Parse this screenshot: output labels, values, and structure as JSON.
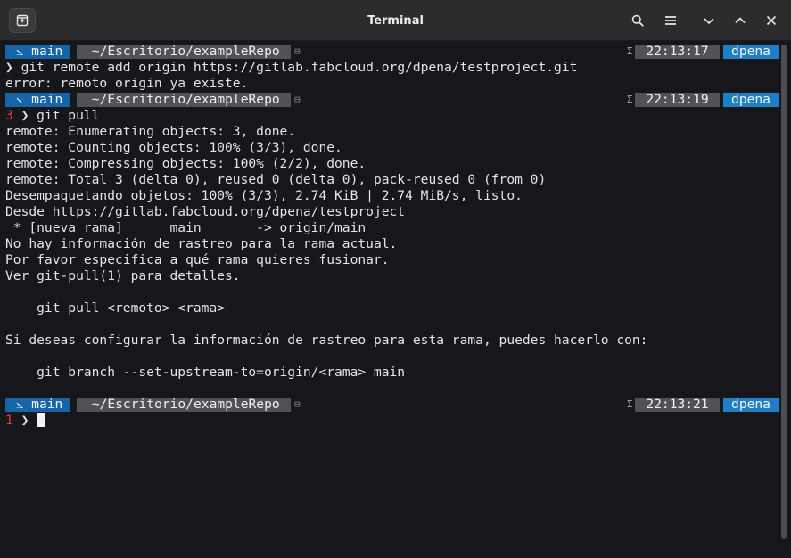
{
  "window": {
    "title": "Terminal"
  },
  "titlebar": {
    "new_tab_icon": "new-tab-icon",
    "search_icon": "search-icon",
    "menu_icon": "hamburger-menu-icon",
    "minimize_icon": "chevron-down-icon",
    "maximize_icon": "chevron-up-icon",
    "close_icon": "close-icon"
  },
  "colors": {
    "branch_segment": "#1565a8",
    "path_segment": "#505256",
    "user_segment": "#1e7fc6",
    "error_status": "#e33b3b"
  },
  "prompts": [
    {
      "branch": "⦣ main",
      "path": " ~/Escritorio/exampleRepo",
      "path_icon": "⊟",
      "sigma": "Σ",
      "time": "22:13:17",
      "user": "dpena"
    },
    {
      "branch": "⦣ main",
      "path": " ~/Escritorio/exampleRepo",
      "path_icon": "⊟",
      "sigma": "Σ",
      "time": "22:13:19",
      "user": "dpena"
    },
    {
      "branch": "⦣ main",
      "path": " ~/Escritorio/exampleRepo",
      "path_icon": "⊟",
      "sigma": "Σ",
      "time": "22:13:21",
      "user": "dpena"
    }
  ],
  "commands": {
    "first": {
      "prefix": "❯ ",
      "text": "git remote add origin https://gitlab.fabcloud.org/dpena/testproject.git"
    },
    "second": {
      "status": "3",
      "prefix": " ❯ ",
      "text": "git pull"
    },
    "third": {
      "status": "1",
      "prefix": " ❯ "
    }
  },
  "output": {
    "first": [
      "error: remoto origin ya existe."
    ],
    "second": [
      "remote: Enumerating objects: 3, done.",
      "remote: Counting objects: 100% (3/3), done.",
      "remote: Compressing objects: 100% (2/2), done.",
      "remote: Total 3 (delta 0), reused 0 (delta 0), pack-reused 0 (from 0)",
      "Desempaquetando objetos: 100% (3/3), 2.74 KiB | 2.74 MiB/s, listo.",
      "Desde https://gitlab.fabcloud.org/dpena/testproject",
      " * [nueva rama]      main       -> origin/main",
      "No hay información de rastreo para la rama actual.",
      "Por favor especifica a qué rama quieres fusionar.",
      "Ver git-pull(1) para detalles.",
      "",
      "    git pull <remoto> <rama>",
      "",
      "Si deseas configurar la información de rastreo para esta rama, puedes hacerlo con:",
      "",
      "    git branch --set-upstream-to=origin/<rama> main",
      ""
    ]
  }
}
